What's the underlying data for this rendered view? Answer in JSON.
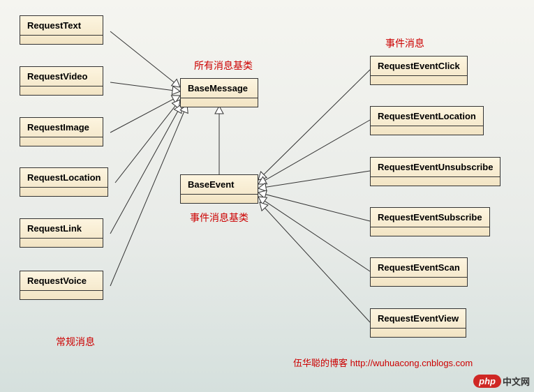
{
  "classes": {
    "base_message": "BaseMessage",
    "base_event": "BaseEvent",
    "left": [
      "RequestText",
      "RequestVideo",
      "RequestImage",
      "RequestLocation",
      "RequestLink",
      "RequestVoice"
    ],
    "right": [
      "RequestEventClick",
      "RequestEventLocation",
      "RequestEventUnsubscribe",
      "RequestEventSubscribe",
      "RequestEventScan",
      "RequestEventView"
    ]
  },
  "annotations": {
    "all_msg_base": "所有消息基类",
    "event_msg": "事件消息",
    "event_msg_base": "事件消息基类",
    "normal_msg": "常规消息"
  },
  "footer": {
    "credit": "伍华聪的博客 http://wuhuacong.cnblogs.com",
    "badge_pill": "php",
    "badge_text": "中文网"
  },
  "chart_data": {
    "type": "diagram",
    "title": "UML class inheritance diagram for message/event request classes",
    "description": "BaseMessage is the root class. Six request message classes inherit from BaseMessage. BaseEvent inherits from BaseMessage. Six request event classes inherit from BaseEvent.",
    "nodes": [
      {
        "id": "BaseMessage",
        "label": "BaseMessage",
        "role": "root",
        "note": "所有消息基类"
      },
      {
        "id": "BaseEvent",
        "label": "BaseEvent",
        "role": "intermediate",
        "note": "事件消息基类"
      },
      {
        "id": "RequestText",
        "label": "RequestText",
        "role": "leaf",
        "group": "常规消息"
      },
      {
        "id": "RequestVideo",
        "label": "RequestVideo",
        "role": "leaf",
        "group": "常规消息"
      },
      {
        "id": "RequestImage",
        "label": "RequestImage",
        "role": "leaf",
        "group": "常规消息"
      },
      {
        "id": "RequestLocation",
        "label": "RequestLocation",
        "role": "leaf",
        "group": "常规消息"
      },
      {
        "id": "RequestLink",
        "label": "RequestLink",
        "role": "leaf",
        "group": "常规消息"
      },
      {
        "id": "RequestVoice",
        "label": "RequestVoice",
        "role": "leaf",
        "group": "常规消息"
      },
      {
        "id": "RequestEventClick",
        "label": "RequestEventClick",
        "role": "leaf",
        "group": "事件消息"
      },
      {
        "id": "RequestEventLocation",
        "label": "RequestEventLocation",
        "role": "leaf",
        "group": "事件消息"
      },
      {
        "id": "RequestEventUnsubscribe",
        "label": "RequestEventUnsubscribe",
        "role": "leaf",
        "group": "事件消息"
      },
      {
        "id": "RequestEventSubscribe",
        "label": "RequestEventSubscribe",
        "role": "leaf",
        "group": "事件消息"
      },
      {
        "id": "RequestEventScan",
        "label": "RequestEventScan",
        "role": "leaf",
        "group": "事件消息"
      },
      {
        "id": "RequestEventView",
        "label": "RequestEventView",
        "role": "leaf",
        "group": "事件消息"
      }
    ],
    "edges": [
      {
        "from": "RequestText",
        "to": "BaseMessage",
        "type": "inherits"
      },
      {
        "from": "RequestVideo",
        "to": "BaseMessage",
        "type": "inherits"
      },
      {
        "from": "RequestImage",
        "to": "BaseMessage",
        "type": "inherits"
      },
      {
        "from": "RequestLocation",
        "to": "BaseMessage",
        "type": "inherits"
      },
      {
        "from": "RequestLink",
        "to": "BaseMessage",
        "type": "inherits"
      },
      {
        "from": "RequestVoice",
        "to": "BaseMessage",
        "type": "inherits"
      },
      {
        "from": "BaseEvent",
        "to": "BaseMessage",
        "type": "inherits"
      },
      {
        "from": "RequestEventClick",
        "to": "BaseEvent",
        "type": "inherits"
      },
      {
        "from": "RequestEventLocation",
        "to": "BaseEvent",
        "type": "inherits"
      },
      {
        "from": "RequestEventUnsubscribe",
        "to": "BaseEvent",
        "type": "inherits"
      },
      {
        "from": "RequestEventSubscribe",
        "to": "BaseEvent",
        "type": "inherits"
      },
      {
        "from": "RequestEventScan",
        "to": "BaseEvent",
        "type": "inherits"
      },
      {
        "from": "RequestEventView",
        "to": "BaseEvent",
        "type": "inherits"
      }
    ]
  }
}
